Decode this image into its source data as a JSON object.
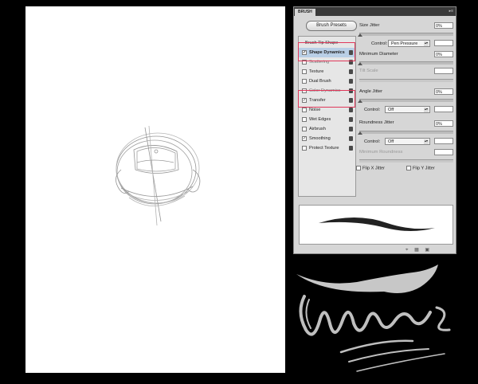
{
  "panel": {
    "tab_title": "BRUSH",
    "presets_button": "Brush Presets",
    "left_items": [
      {
        "label": "Brush Tip Shape",
        "checked": false,
        "type": "header"
      },
      {
        "label": "Shape Dynamics",
        "checked": true,
        "type": "selected"
      },
      {
        "label": "Scattering",
        "checked": false,
        "type": "normal"
      },
      {
        "label": "Texture",
        "checked": false,
        "type": "normal"
      },
      {
        "label": "Dual Brush",
        "checked": false,
        "type": "normal"
      },
      {
        "label": "Color Dynamics",
        "checked": false,
        "type": "normal"
      },
      {
        "label": "Transfer",
        "checked": true,
        "type": "normal"
      },
      {
        "label": "Noise",
        "checked": false,
        "type": "normal"
      },
      {
        "label": "Wet Edges",
        "checked": false,
        "type": "normal"
      },
      {
        "label": "Airbrush",
        "checked": false,
        "type": "normal"
      },
      {
        "label": "Smoothing",
        "checked": true,
        "type": "normal"
      },
      {
        "label": "Protect Texture",
        "checked": false,
        "type": "normal"
      }
    ],
    "size_jitter": {
      "label": "Size Jitter",
      "value": "0%"
    },
    "size_control": {
      "label": "Control:",
      "value": "Pen Pressure"
    },
    "min_diameter": {
      "label": "Minimum Diameter",
      "value": "0%"
    },
    "tilt_scale": {
      "label": "Tilt Scale"
    },
    "angle_jitter": {
      "label": "Angle Jitter",
      "value": "0%"
    },
    "angle_control": {
      "label": "Control:",
      "value": "Off"
    },
    "roundness_jitter": {
      "label": "Roundness Jitter",
      "value": "0%"
    },
    "roundness_control": {
      "label": "Control:",
      "value": "Off"
    },
    "min_roundness": {
      "label": "Minimum Roundness"
    },
    "flip_x": "Flip X Jitter",
    "flip_y": "Flip Y Jitter",
    "bottom_icons": [
      "eye-brush-icon",
      "grid-icon",
      "new-preset-icon"
    ]
  },
  "colors": {
    "background": "#000000",
    "canvas": "#ffffff",
    "panel": "#d6d6d6",
    "highlight": "#e0385a",
    "selected_row": "#b9cfe6"
  }
}
